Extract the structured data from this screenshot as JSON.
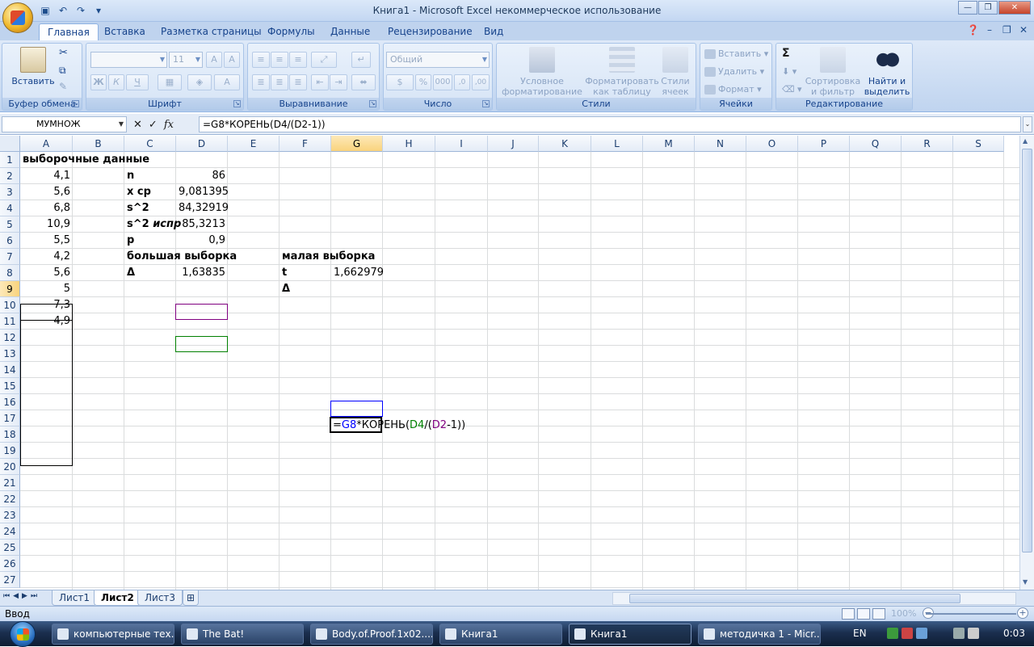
{
  "window": {
    "title": "Книга1 - Microsoft Excel некоммерческое использование"
  },
  "ribbon_tabs": [
    "Главная",
    "Вставка",
    "Разметка страницы",
    "Формулы",
    "Данные",
    "Рецензирование",
    "Вид"
  ],
  "ribbon": {
    "clipboard": {
      "label": "Буфер обмена",
      "paste": "Вставить"
    },
    "font": {
      "label": "Шрифт",
      "font_size": "11",
      "bold": "Ж",
      "italic": "К",
      "underline": "Ч"
    },
    "alignment": {
      "label": "Выравнивание"
    },
    "number": {
      "label": "Число",
      "format": "Общий",
      "percent": "%",
      "thousands": "000"
    },
    "styles": {
      "label": "Стили",
      "conditional_1": "Условное",
      "conditional_2": "форматирование",
      "table_1": "Форматировать",
      "table_2": "как таблицу",
      "cell_styles_1": "Стили",
      "cell_styles_2": "ячеек"
    },
    "cells": {
      "label": "Ячейки",
      "insert": "Вставить",
      "delete": "Удалить",
      "format": "Формат"
    },
    "editing": {
      "label": "Редактирование",
      "sum": "Σ",
      "sort_1": "Сортировка",
      "sort_2": "и фильтр",
      "find_1": "Найти и",
      "find_2": "выделить"
    }
  },
  "formula_bar": {
    "name_box": "МУМНОЖ",
    "fx": "fx",
    "formula": "=G8*КОРЕНЬ(D4/(D2-1))"
  },
  "columns": [
    "A",
    "B",
    "C",
    "D",
    "E",
    "F",
    "G",
    "H",
    "I",
    "J",
    "K",
    "L",
    "M",
    "N",
    "O",
    "P",
    "Q",
    "R",
    "S"
  ],
  "rows": [
    "1",
    "2",
    "3",
    "4",
    "5",
    "6",
    "7",
    "8",
    "9",
    "10",
    "11",
    "12",
    "13",
    "14",
    "15",
    "16",
    "17",
    "18",
    "19",
    "20",
    "21",
    "22",
    "23",
    "24",
    "25",
    "26",
    "27"
  ],
  "cells": {
    "A1": "выборочные данные",
    "A2": "4,1",
    "A3": "5,6",
    "A4": "6,8",
    "A5": "10,9",
    "A6": "5,5",
    "A7": "4,2",
    "A8": "5,6",
    "A9": "5",
    "A10": "7,3",
    "A11": "4,9",
    "C2": "n",
    "C3": "x ср",
    "C4": "s^2",
    "C5": "s^2 испр",
    "C6": "p",
    "C7": "большая выборка",
    "C8": "Δ",
    "D2": "86",
    "D3": "9,081395",
    "D4": "84,32919",
    "D5": "85,3213",
    "D6": "0,9",
    "D8": "1,63835",
    "F7": "малая выборка",
    "F8": "t",
    "F9": "Δ",
    "G8": "1,662979"
  },
  "edit_cell": {
    "parts": [
      {
        "text": "=",
        "color": "#000000"
      },
      {
        "text": "G8",
        "color": "#0000ff"
      },
      {
        "text": "*КОРЕНЬ(",
        "color": "#000000"
      },
      {
        "text": "D4",
        "color": "#008000"
      },
      {
        "text": "/(",
        "color": "#000000"
      },
      {
        "text": "D2",
        "color": "#800080"
      },
      {
        "text": "-1",
        "color": "#000000"
      },
      {
        "text": "))",
        "color": "#000000"
      }
    ]
  },
  "sheets": [
    "Лист1",
    "Лист2",
    "Лист3"
  ],
  "active_sheet": "Лист2",
  "status": {
    "mode": "Ввод",
    "zoom": "100%"
  },
  "taskbar": {
    "items": [
      "компьютерные тех...",
      "The Bat!",
      "Body.of.Proof.1x02....",
      "Книга1",
      "Книга1",
      "методичка 1 - Micr..."
    ],
    "active_index": 4,
    "lang": "EN",
    "time": "0:03"
  }
}
